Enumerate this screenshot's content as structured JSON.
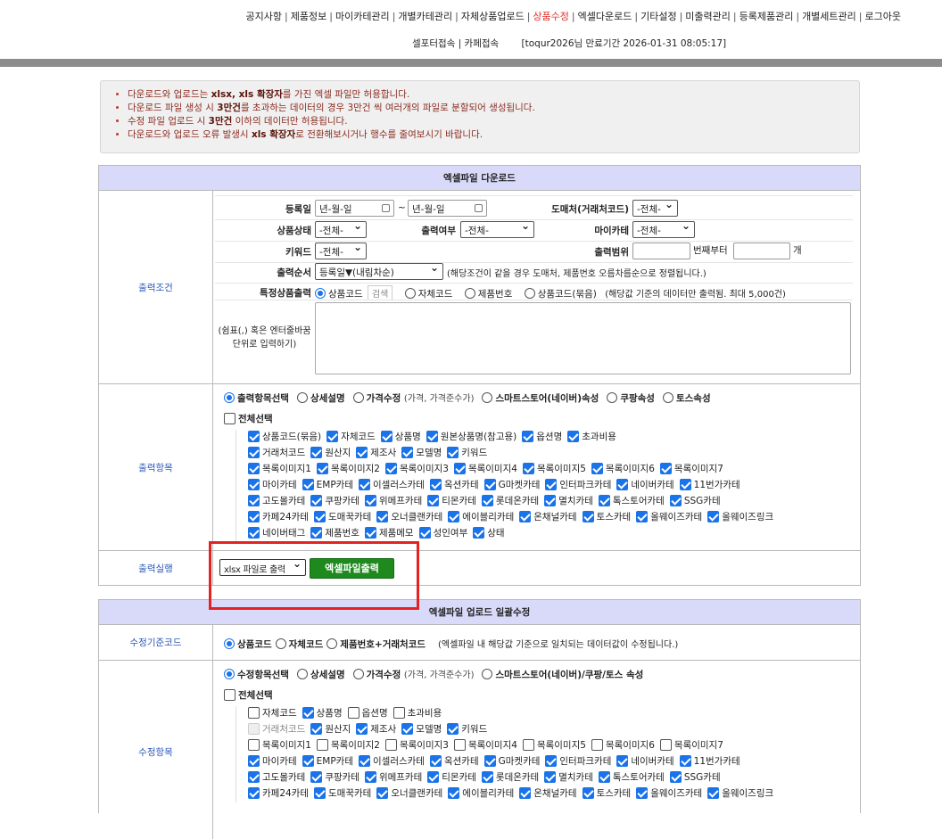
{
  "top_nav": [
    {
      "label": "공지사항"
    },
    {
      "label": "제품정보"
    },
    {
      "label": "마이카테관리"
    },
    {
      "label": "개별카테관리"
    },
    {
      "label": "자체상품업로드"
    },
    {
      "label": "상품수정",
      "active": true
    },
    {
      "label": "엑셀다운로드"
    },
    {
      "label": "기타설정"
    },
    {
      "label": "미출력관리"
    },
    {
      "label": "등록제품관리"
    },
    {
      "label": "개별세트관리"
    },
    {
      "label": "로그아웃"
    }
  ],
  "sub_nav": {
    "seller": "셀포터접속",
    "sep": "|",
    "cafe": "카페접속",
    "account_info": "[toqur2026님 만료기간 2026-01-31 08:05:17]"
  },
  "notices": [
    [
      "다운로드와 업로드는 ",
      "xlsx, xls 확장자",
      "를 가진 엑셀 파일만 허용합니다."
    ],
    [
      "다운로드 파일 생성 시 ",
      "3만건",
      "를 초과하는 데이터의 경우 3만건 씩 여러개의 파일로 분할되어 생성됩니다."
    ],
    [
      "수정 파일 업로드 시 ",
      "3만건",
      " 이하의 데이터만 허용됩니다."
    ],
    [
      "다운로드와 업로드 오류 발생시 ",
      "xls 확장자",
      "로 전환해보시거나 행수를 줄여보시기 바랍니다."
    ]
  ],
  "download": {
    "title": "엑셀파일 다운로드",
    "cond_label": "출력조건",
    "reg_date_label": "등록일",
    "date_placeholder": "년-월-일",
    "tilde": "~",
    "supplier_label": "도매처(거래처코드)",
    "supplier_value": "-전체-",
    "status_label": "상품상태",
    "status_value": "-전체-",
    "printed_label": "출력여부",
    "printed_value": "-전체-",
    "mycate_label": "마이카테",
    "mycate_value": "-전체-",
    "keyword_label": "키워드",
    "keyword_value": "-전체-",
    "range_label": "출력범위",
    "range_from_suffix": "번째부터",
    "range_to_suffix": "개",
    "order_label": "출력순서",
    "order_value": "등록일▼(내림차순)",
    "order_note": "(해당조건이 같을 경우 도매처, 제품번호 오름차름순으로 정렬됩니다.)",
    "specific_label": "특정상품출력",
    "specific_options": [
      "상품코드",
      "자체코드",
      "제품번호",
      "상품코드(묶음)"
    ],
    "search_btn": "검색",
    "specific_note": "(해당값 기준의 데이터만 출력됨. 최대 5,000건)",
    "textarea_hint": "(쉼표(,) 혹은 엔터줄바꿈 단위로 입력하기)",
    "items_label": "출력항목",
    "mode_options": [
      {
        "label": "출력항목선택",
        "on": true
      },
      {
        "label": "상세설명"
      },
      {
        "label": "가격수정",
        "sub": "(가격, 가격준수가)"
      },
      {
        "label": "스마트스토어(네이버)속성"
      },
      {
        "label": "쿠팡속성"
      },
      {
        "label": "토스속성"
      }
    ],
    "select_all": "전체선택",
    "item_rows": [
      [
        [
          "상품코드(묶음)",
          1
        ],
        [
          "자체코드",
          1
        ],
        [
          "상품명",
          1
        ],
        [
          "원본상품명(참고용)",
          1
        ],
        [
          "옵션명",
          1
        ],
        [
          "초과비용",
          1
        ]
      ],
      [
        [
          "거래처코드",
          1
        ],
        [
          "원산지",
          1
        ],
        [
          "제조사",
          1
        ],
        [
          "모델명",
          1
        ],
        [
          "키워드",
          1
        ]
      ],
      [
        [
          "목록이미지1",
          1
        ],
        [
          "목록이미지2",
          1
        ],
        [
          "목록이미지3",
          1
        ],
        [
          "목록이미지4",
          1
        ],
        [
          "목록이미지5",
          1
        ],
        [
          "목록이미지6",
          1
        ],
        [
          "목록이미지7",
          1
        ]
      ],
      [
        [
          "마이카테",
          1
        ],
        [
          "EMP카테",
          1
        ],
        [
          "이셀러스카테",
          1
        ],
        [
          "옥션카테",
          1
        ],
        [
          "G마켓카테",
          1
        ],
        [
          "인터파크카테",
          1
        ],
        [
          "네이버카테",
          1
        ],
        [
          "11번가카테",
          1
        ]
      ],
      [
        [
          "고도몰카테",
          1
        ],
        [
          "쿠팡카테",
          1
        ],
        [
          "위메프카테",
          1
        ],
        [
          "티몬카테",
          1
        ],
        [
          "롯데온카테",
          1
        ],
        [
          "멸치카테",
          1
        ],
        [
          "톡스토어카테",
          1
        ],
        [
          "SSG카테",
          1
        ]
      ],
      [
        [
          "카페24카테",
          1
        ],
        [
          "도매꾹카테",
          1
        ],
        [
          "오너클랜카테",
          1
        ],
        [
          "에이블리카테",
          1
        ],
        [
          "온채널카테",
          1
        ],
        [
          "토스카테",
          1
        ],
        [
          "올웨이즈카테",
          1
        ],
        [
          "올웨이즈링크",
          1
        ]
      ],
      [
        [
          "네이버태그",
          1
        ],
        [
          "제품번호",
          1
        ],
        [
          "제품메모",
          1
        ],
        [
          "성인여부",
          1
        ],
        [
          "상태",
          1
        ]
      ]
    ],
    "run_label": "출력실행",
    "format_value": "xlsx 파일로 출력",
    "export_btn": "엑셀파일출력"
  },
  "upload": {
    "title": "엑셀파일 업로드 일괄수정",
    "basis_label": "수정기준코드",
    "basis_options": [
      {
        "label": "상품코드",
        "on": true
      },
      {
        "label": "자체코드"
      },
      {
        "label": "제품번호+거래처코드"
      }
    ],
    "basis_note": "(엑셀파일 내 해당값 기준으로 일치되는 데이터값이 수정됩니다.)",
    "items_label": "수정항목",
    "mode_options": [
      {
        "label": "수정항목선택",
        "on": true
      },
      {
        "label": "상세설명"
      },
      {
        "label": "가격수정",
        "sub": "(가격, 가격준수가)"
      },
      {
        "label": "스마트스토어(네이버)/쿠팡/토스 속성"
      }
    ],
    "select_all": "전체선택",
    "item_rows": [
      [
        [
          "자체코드",
          0
        ],
        [
          "상품명",
          1
        ],
        [
          "옵션명",
          0
        ],
        [
          "초과비용",
          0
        ]
      ],
      [
        [
          "거래처코드",
          2
        ],
        [
          "원산지",
          1
        ],
        [
          "제조사",
          1
        ],
        [
          "모델명",
          1
        ],
        [
          "키워드",
          1
        ]
      ],
      [
        [
          "목록이미지1",
          0
        ],
        [
          "목록이미지2",
          0
        ],
        [
          "목록이미지3",
          0
        ],
        [
          "목록이미지4",
          0
        ],
        [
          "목록이미지5",
          0
        ],
        [
          "목록이미지6",
          0
        ],
        [
          "목록이미지7",
          0
        ]
      ],
      [
        [
          "마이카테",
          1
        ],
        [
          "EMP카테",
          1
        ],
        [
          "이셀러스카테",
          1
        ],
        [
          "옥션카테",
          1
        ],
        [
          "G마켓카테",
          1
        ],
        [
          "인터파크카테",
          1
        ],
        [
          "네이버카테",
          1
        ],
        [
          "11번가카테",
          1
        ]
      ],
      [
        [
          "고도몰카테",
          1
        ],
        [
          "쿠팡카테",
          1
        ],
        [
          "위메프카테",
          1
        ],
        [
          "티몬카테",
          1
        ],
        [
          "롯데온카테",
          1
        ],
        [
          "멸치카테",
          1
        ],
        [
          "톡스토어카테",
          1
        ],
        [
          "SSG카테",
          1
        ]
      ],
      [
        [
          "카페24카테",
          1
        ],
        [
          "도매꾹카테",
          1
        ],
        [
          "오너클랜카테",
          1
        ],
        [
          "에이블리카테",
          1
        ],
        [
          "온채널카테",
          1
        ],
        [
          "토스카테",
          1
        ],
        [
          "올웨이즈카테",
          1
        ],
        [
          "올웨이즈링크",
          1
        ]
      ]
    ]
  },
  "colors": {
    "active_nav": "#e0302a",
    "header_bg": "#d9d9fa",
    "label_blue": "#2a58b8",
    "export_green": "#1e8a1e",
    "highlight": "#e52222"
  }
}
